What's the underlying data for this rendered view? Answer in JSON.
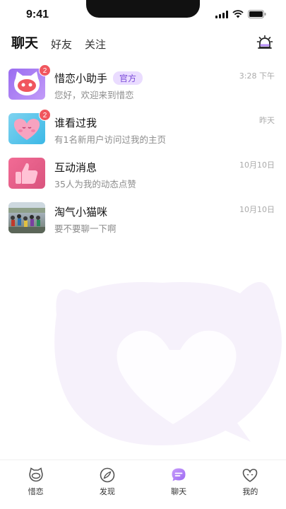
{
  "status_bar": {
    "time": "9:41"
  },
  "top_tabs": [
    {
      "label": "聊天",
      "active": true
    },
    {
      "label": "好友",
      "active": false
    },
    {
      "label": "关注",
      "active": false
    }
  ],
  "icons": {
    "alarm": "alarm-icon"
  },
  "chats": [
    {
      "name": "惜恋小助手",
      "tag": "官方",
      "preview": "您好，欢迎来到惜恋",
      "time": "3:28 下午",
      "badge": "2",
      "avatar": "cat-mascot"
    },
    {
      "name": "谁看过我",
      "tag": "",
      "preview": "有1名新用户访问过我的主页",
      "time": "昨天",
      "badge": "2",
      "avatar": "pink-heart"
    },
    {
      "name": "互动消息",
      "tag": "",
      "preview": "35人为我的动态点赞",
      "time": "10月10日",
      "badge": "",
      "avatar": "thumbs-up"
    },
    {
      "name": "淘气小猫咪",
      "tag": "",
      "preview": "要不要聊一下啊",
      "time": "10月10日",
      "badge": "",
      "avatar": "crowd-photo"
    }
  ],
  "bottom_nav": [
    {
      "label": "惜恋",
      "icon": "cat-face-icon",
      "active": false
    },
    {
      "label": "发现",
      "icon": "compass-icon",
      "active": false
    },
    {
      "label": "聊天",
      "icon": "chat-bubble-icon",
      "active": true
    },
    {
      "label": "我的",
      "icon": "heart-face-icon",
      "active": false
    }
  ],
  "colors": {
    "accent": "#b58cf5",
    "badge": "#f0565e",
    "tag_bg": "#eadcff"
  }
}
